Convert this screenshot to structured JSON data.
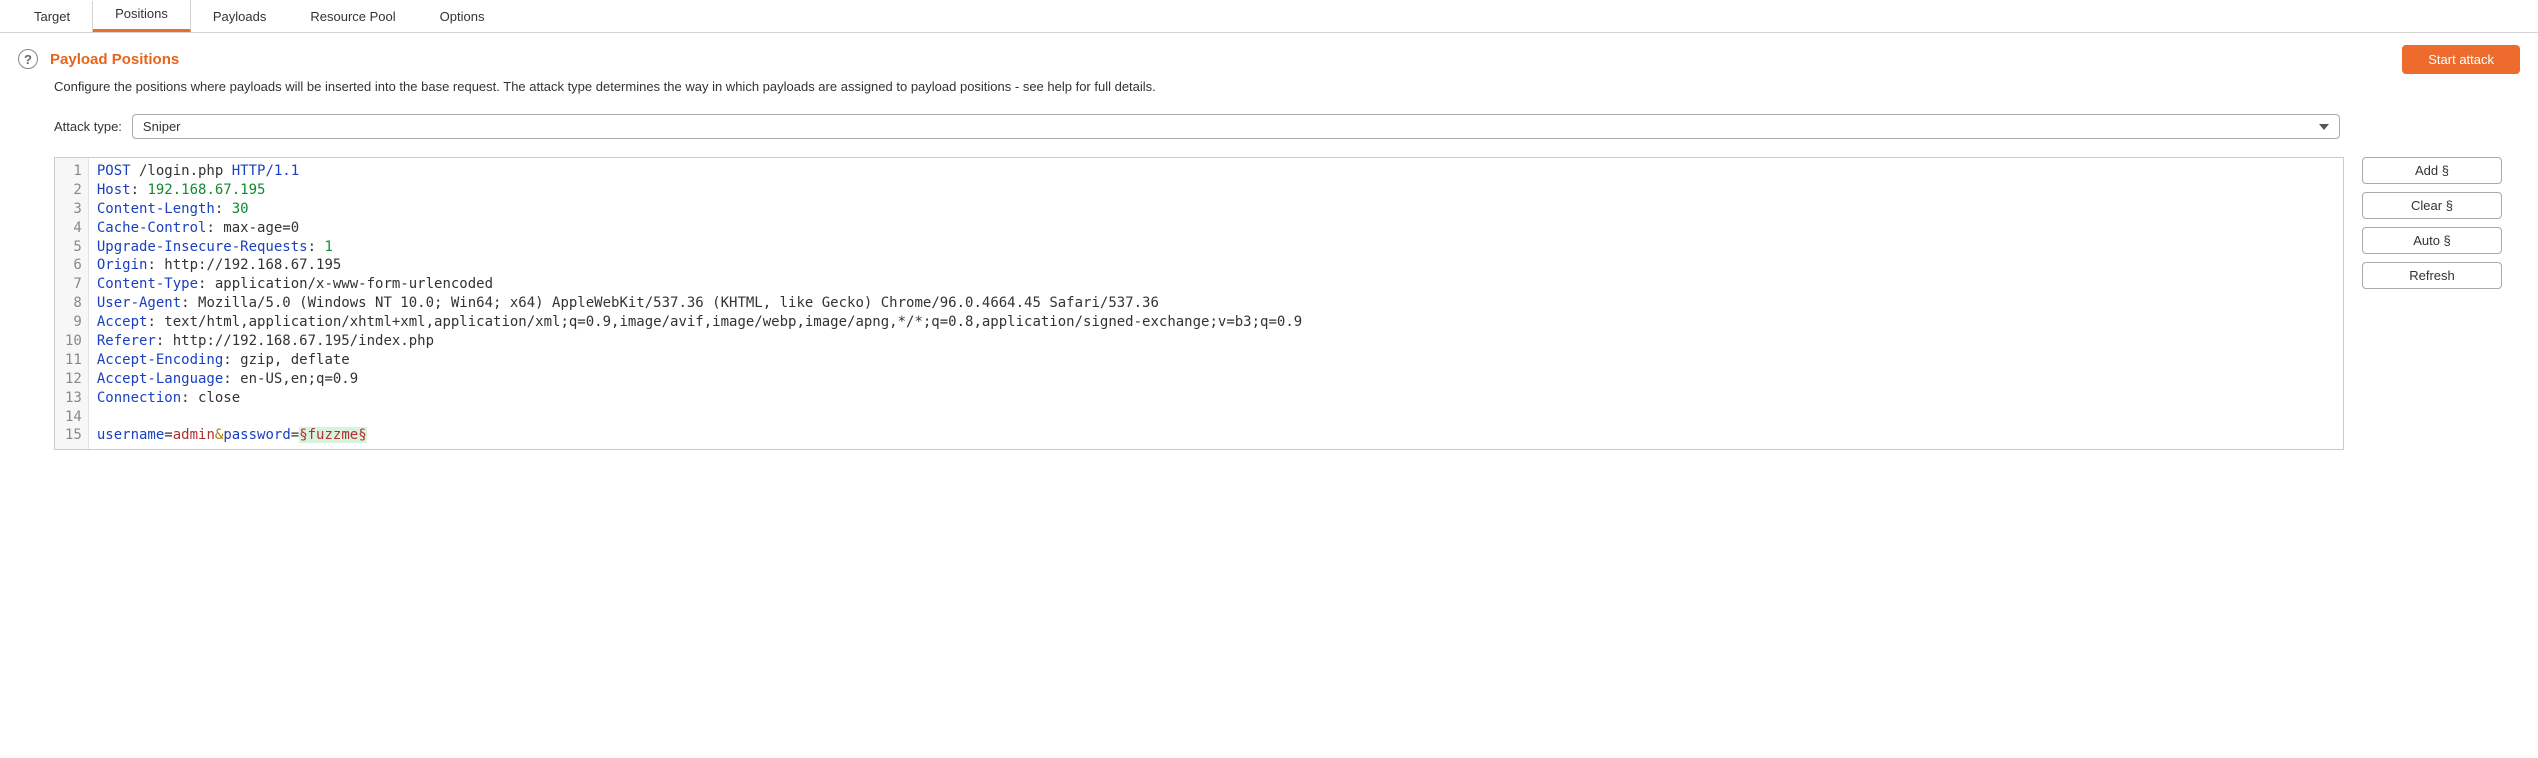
{
  "tabs": {
    "target": "Target",
    "positions": "Positions",
    "payloads": "Payloads",
    "resource_pool": "Resource Pool",
    "options": "Options"
  },
  "section": {
    "title": "Payload Positions",
    "help_glyph": "?",
    "description": "Configure the positions where payloads will be inserted into the base request. The attack type determines the way in which payloads are assigned to payload positions - see help for full details."
  },
  "start_attack_label": "Start attack",
  "attack_type": {
    "label": "Attack type:",
    "selected": "Sniper"
  },
  "side_buttons": {
    "add": "Add §",
    "clear": "Clear §",
    "auto": "Auto §",
    "refresh": "Refresh"
  },
  "request": {
    "line1_method": "POST",
    "line1_path": " /login.php ",
    "line1_proto": "HTTP/1.1",
    "h_host": "Host",
    "v_host": "192.168.67.195",
    "h_cl": "Content-Length",
    "v_cl": "30",
    "h_cc": "Cache-Control",
    "v_cc": "max-age=0",
    "h_uir": "Upgrade-Insecure-Requests",
    "v_uir": "1",
    "h_origin": "Origin",
    "v_origin": "http://192.168.67.195",
    "h_ct": "Content-Type",
    "v_ct": "application/x-www-form-urlencoded",
    "h_ua": "User-Agent",
    "v_ua": "Mozilla/5.0 (Windows NT 10.0; Win64; x64) AppleWebKit/537.36 (KHTML, like Gecko) Chrome/96.0.4664.45 Safari/537.36",
    "h_accept": "Accept",
    "v_accept": "text/html,application/xhtml+xml,application/xml;q=0.9,image/avif,image/webp,image/apng,*/*;q=0.8,application/signed-exchange;v=b3;q=0.9",
    "h_ref": "Referer",
    "v_ref": "http://192.168.67.195/index.php",
    "h_ae": "Accept-Encoding",
    "v_ae": "gzip, deflate",
    "h_al": "Accept-Language",
    "v_al": "en-US,en;q=0.9",
    "h_conn": "Connection",
    "v_conn": "close",
    "body_p1": "username",
    "body_v1": "admin",
    "body_amp": "&",
    "body_p2": "password",
    "body_eq": "=",
    "body_marker": "§fuzzme§",
    "colon": ": "
  },
  "line_numbers": [
    "1",
    "2",
    "3",
    "4",
    "5",
    "6",
    "7",
    "8",
    "9",
    "10",
    "11",
    "12",
    "13",
    "14",
    "15"
  ]
}
